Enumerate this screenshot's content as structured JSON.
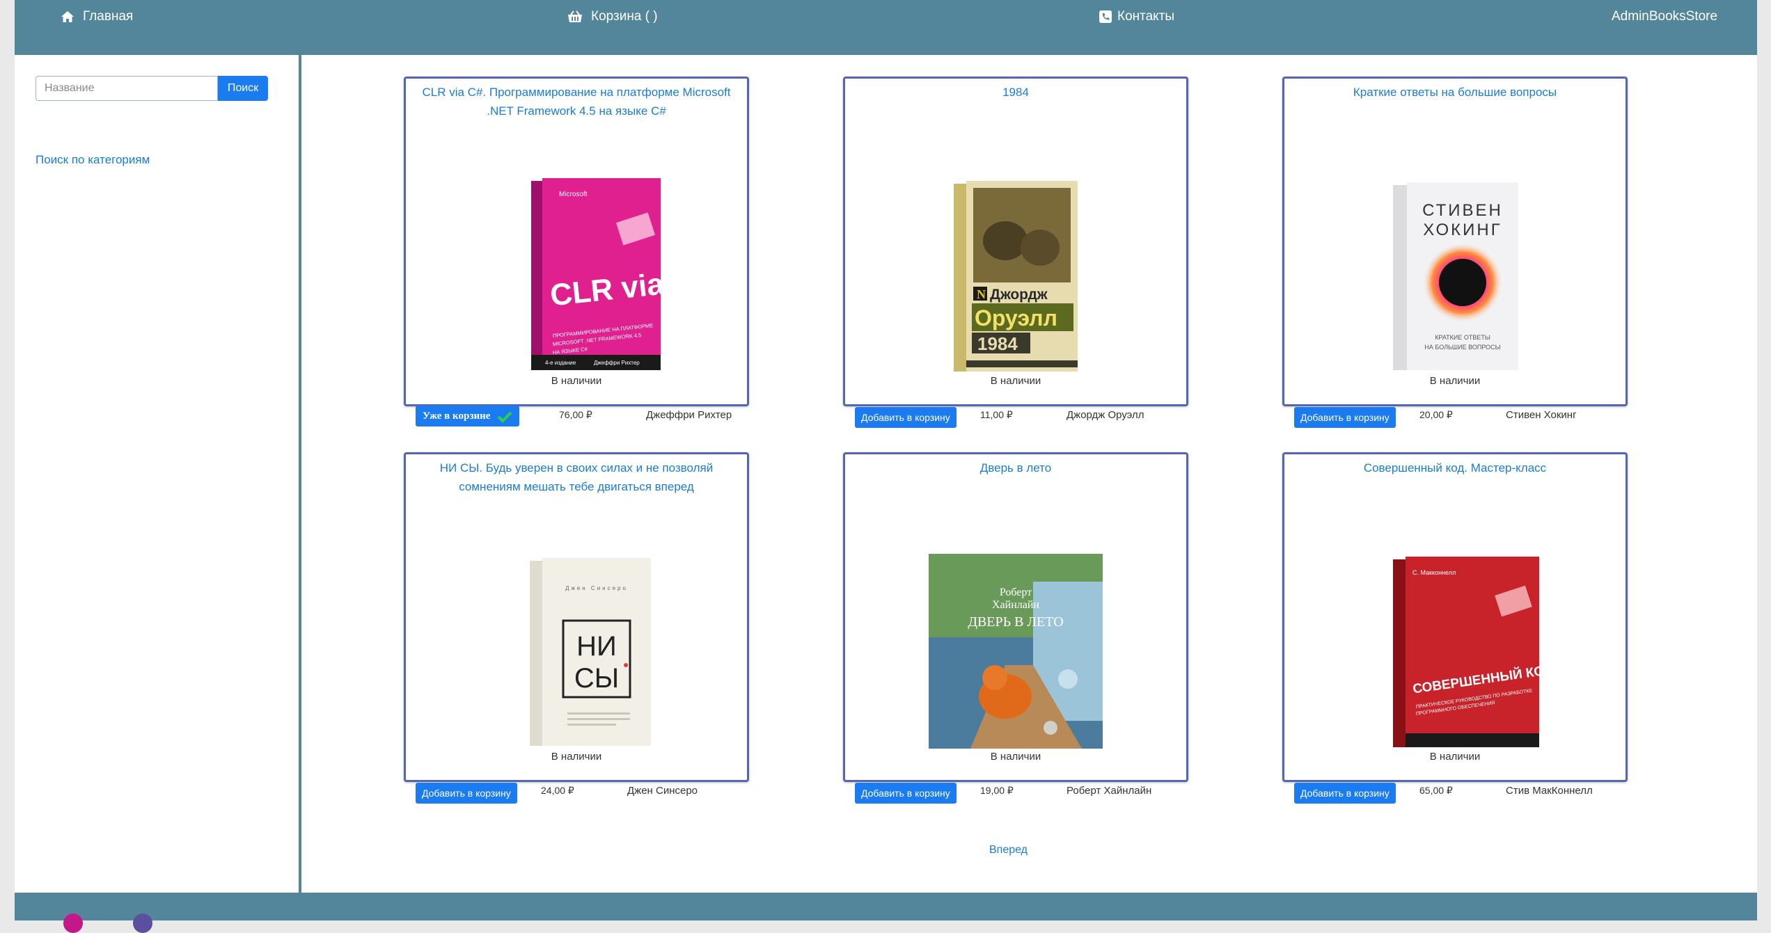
{
  "nav": {
    "home": "Главная",
    "cart": "Корзина ( )",
    "contacts": "Контакты",
    "admin": "AdminBooksStore"
  },
  "sidebar": {
    "search_placeholder": "Название",
    "search_button": "Поиск",
    "categories_link": "Поиск по категориям"
  },
  "books": [
    {
      "title": "CLR via C#. Программирование на платформе Microsoft .NET Framework 4.5 на языке C#",
      "availability": "В наличии",
      "button": "Уже в корзине",
      "in_cart": true,
      "price": "76,00 ₽",
      "author": "Джеффри Рихтер",
      "cover_color": "#e0208f",
      "cover_text": [
        "CLR via C#",
        "Программирование на платформе Microsoft .NET Framework 4.5 на языке C#",
        "4-е издание",
        "Джеффри Рихтер"
      ]
    },
    {
      "title": "1984",
      "availability": "В наличии",
      "button": "Добавить в корзину",
      "in_cart": false,
      "price": "11,00 ₽",
      "author": "Джордж Оруэлл",
      "cover_color": "#e6dcb0",
      "cover_text": [
        "Джордж",
        "Оруэлл",
        "1984"
      ]
    },
    {
      "title": "Краткие ответы на большие вопросы",
      "availability": "В наличии",
      "button": "Добавить в корзину",
      "in_cart": false,
      "price": "20,00 ₽",
      "author": "Стивен Хокинг",
      "cover_color": "#f2f2f4",
      "cover_text": [
        "СТИВЕН",
        "ХОКИНГ",
        "КРАТКИЕ ОТВЕТЫ",
        "НА БОЛЬШИЕ ВОПРОСЫ"
      ]
    },
    {
      "title": "НИ СЫ. Будь уверен в своих силах и не позволяй сомнениям мешать тебе двигаться вперед",
      "availability": "В наличии",
      "button": "Добавить в корзину",
      "in_cart": false,
      "price": "24,00 ₽",
      "author": "Джен Синсеро",
      "cover_color": "#f1efe6",
      "cover_text": [
        "Джен Синсеро",
        "НИ",
        "СЫ"
      ]
    },
    {
      "title": "Дверь в лето",
      "availability": "В наличии",
      "button": "Добавить в корзину",
      "in_cart": false,
      "price": "19,00 ₽",
      "author": "Роберт Хайнлайн",
      "cover_color": "#4b7c9e",
      "cover_text": [
        "Роберт",
        "Хайнлайн",
        "ДВЕРЬ В ЛЕТО"
      ]
    },
    {
      "title": "Совершенный код. Мастер-класс",
      "availability": "В наличии",
      "button": "Добавить в корзину",
      "in_cart": false,
      "price": "65,00 ₽",
      "author": "Стив МакКоннелл",
      "cover_color": "#c8232a",
      "cover_text": [
        "С. Макконнелл",
        "СОВЕРШЕННЫЙ КОД",
        "Практическое руководство по разработке программного обеспечения"
      ]
    }
  ],
  "pager": {
    "next": "Вперед"
  },
  "colors": {
    "navbar": "#53869a",
    "accent": "#1a7cf0",
    "link": "#1a7cd6",
    "card_border": "#5565b5"
  }
}
